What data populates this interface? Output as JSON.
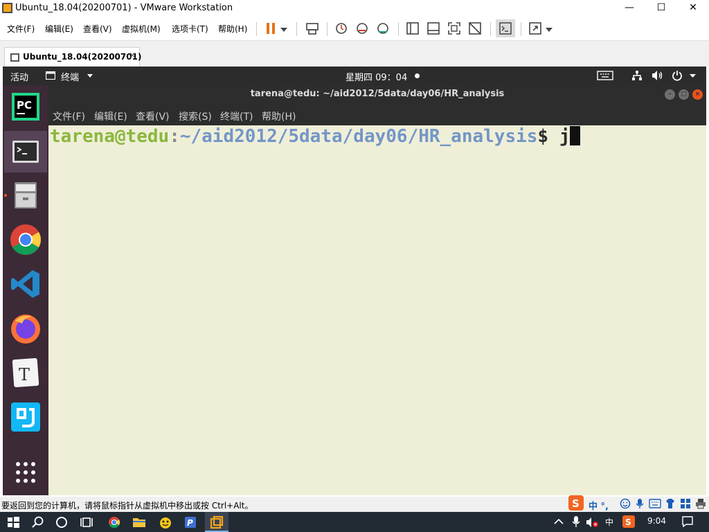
{
  "vmware": {
    "window_title": "Ubuntu_18.04(20200701) - VMware Workstation",
    "window_controls": {
      "minimize": "—",
      "maximize": "☐",
      "close": "✕"
    },
    "menu": [
      "文件(F)",
      "编辑(E)",
      "查看(V)",
      "虚拟机(M)",
      "选项卡(T)",
      "帮助(H)"
    ],
    "tab": {
      "label": "Ubuntu_18.04(20200701)",
      "close": "×"
    },
    "status_text": "要返回到您的计算机，请将鼠标指针从虚拟机中移出或按 Ctrl+Alt。",
    "ime_indicator": "中 °,",
    "accent_color": "#f5a31a"
  },
  "ubuntu": {
    "activities": "活动",
    "app_menu": "终端",
    "clock": "星期四 09：04",
    "dock": [
      {
        "name": "pycharm-icon"
      },
      {
        "name": "terminal-icon",
        "active": true
      },
      {
        "name": "files-icon",
        "running": true
      },
      {
        "name": "chrome-icon"
      },
      {
        "name": "vscode-icon"
      },
      {
        "name": "firefox-icon"
      },
      {
        "name": "text-editor-icon",
        "glyph": "T"
      },
      {
        "name": "qq-icon"
      },
      {
        "name": "show-apps-icon"
      }
    ],
    "topbar_color": "#2c2c2c",
    "dock_color": "#3c2a37"
  },
  "terminal": {
    "title": "tarena@tedu: ~/aid2012/5data/day06/HR_analysis",
    "menu": [
      "文件(F)",
      "编辑(E)",
      "查看(V)",
      "搜索(S)",
      "终端(T)",
      "帮助(H)"
    ],
    "prompt_user": "tarena@tedu",
    "prompt_colon": ":",
    "prompt_path": "~/aid2012/5data/day06/HR_analysis",
    "prompt_symbol": "$ ",
    "command": "j",
    "background": "#efefd8"
  },
  "taskbar": {
    "ime": "中",
    "time": "9:04"
  }
}
